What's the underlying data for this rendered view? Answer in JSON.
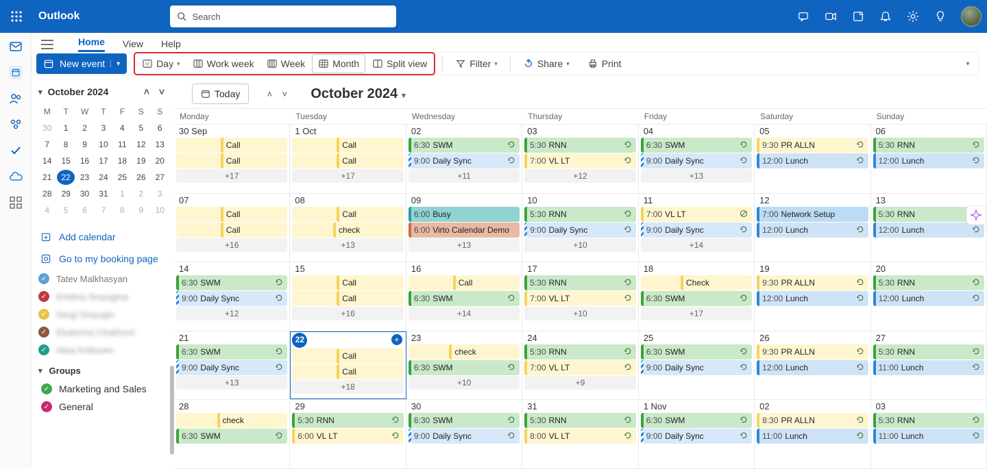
{
  "app": {
    "name": "Outlook"
  },
  "search": {
    "placeholder": "Search"
  },
  "tabs": {
    "home": "Home",
    "view": "View",
    "help": "Help"
  },
  "toolbar": {
    "newEvent": "New event",
    "day": "Day",
    "workweek": "Work week",
    "week": "Week",
    "month": "Month",
    "splitview": "Split view",
    "filter": "Filter",
    "share": "Share",
    "print": "Print"
  },
  "mini": {
    "title": "October 2024",
    "dow": [
      "M",
      "T",
      "W",
      "T",
      "F",
      "S",
      "S"
    ],
    "rows": [
      [
        {
          "n": "30",
          "off": true
        },
        {
          "n": "1"
        },
        {
          "n": "2"
        },
        {
          "n": "3"
        },
        {
          "n": "4"
        },
        {
          "n": "5"
        },
        {
          "n": "6"
        }
      ],
      [
        {
          "n": "7"
        },
        {
          "n": "8"
        },
        {
          "n": "9"
        },
        {
          "n": "10"
        },
        {
          "n": "11"
        },
        {
          "n": "12"
        },
        {
          "n": "13"
        }
      ],
      [
        {
          "n": "14"
        },
        {
          "n": "15"
        },
        {
          "n": "16"
        },
        {
          "n": "17"
        },
        {
          "n": "18"
        },
        {
          "n": "19"
        },
        {
          "n": "20"
        }
      ],
      [
        {
          "n": "21"
        },
        {
          "n": "22",
          "today": true
        },
        {
          "n": "23"
        },
        {
          "n": "24"
        },
        {
          "n": "25"
        },
        {
          "n": "26"
        },
        {
          "n": "27"
        }
      ],
      [
        {
          "n": "28"
        },
        {
          "n": "29"
        },
        {
          "n": "30"
        },
        {
          "n": "31"
        },
        {
          "n": "1",
          "off": true
        },
        {
          "n": "2",
          "off": true
        },
        {
          "n": "3",
          "off": true
        }
      ],
      [
        {
          "n": "4",
          "off": true
        },
        {
          "n": "5",
          "off": true
        },
        {
          "n": "6",
          "off": true
        },
        {
          "n": "7",
          "off": true
        },
        {
          "n": "8",
          "off": true
        },
        {
          "n": "9",
          "off": true
        },
        {
          "n": "10",
          "off": true
        }
      ]
    ]
  },
  "sideactions": {
    "addCalendar": "Add calendar",
    "booking": "Go to my booking page"
  },
  "people": [
    {
      "name": "Tatev Malkhasyan",
      "color": "#5fa0d8"
    },
    {
      "name": "Kristina Smyugina",
      "color": "#c43b3b"
    },
    {
      "name": "Sergi Smyugin",
      "color": "#e9c44a"
    },
    {
      "name": "Ekaterina Chukhont",
      "color": "#8c5a3b"
    },
    {
      "name": "Alisa Kettunen",
      "color": "#1f9e8a"
    }
  ],
  "groups": {
    "title": "Groups",
    "items": [
      {
        "name": "Marketing and Sales",
        "color": "#3fa64f"
      },
      {
        "name": "General",
        "color": "#c72b78"
      }
    ]
  },
  "monthHeader": {
    "today": "Today",
    "title": "October 2024"
  },
  "dow": [
    "Monday",
    "Tuesday",
    "Wednesday",
    "Thursday",
    "Friday",
    "Saturday",
    "Sunday"
  ],
  "weeks": [
    [
      {
        "num": "30 Sep",
        "events": [
          {
            "c": "yellow",
            "label": "Call",
            "center": true
          },
          {
            "c": "yellow",
            "label": "Call",
            "center": true
          }
        ],
        "more": "+17"
      },
      {
        "num": "1 Oct",
        "events": [
          {
            "c": "yellow",
            "label": "Call",
            "center": true
          },
          {
            "c": "yellow",
            "label": "Call",
            "center": true
          }
        ],
        "more": "+17"
      },
      {
        "num": "02",
        "events": [
          {
            "c": "green",
            "time": "6:30",
            "label": "SWM",
            "rec": true
          },
          {
            "c": "hatch-blue",
            "time": "9:00",
            "label": "Daily Sync",
            "rec": true
          }
        ],
        "more": "+11"
      },
      {
        "num": "03",
        "events": [
          {
            "c": "green",
            "time": "5:30",
            "label": "RNN",
            "rec": true
          },
          {
            "c": "yellow",
            "time": "7:00",
            "label": "VL LT",
            "rec": true
          }
        ],
        "more": "+12"
      },
      {
        "num": "04",
        "events": [
          {
            "c": "green",
            "time": "6:30",
            "label": "SWM",
            "rec": true
          },
          {
            "c": "hatch-blue",
            "time": "9:00",
            "label": "Daily Sync",
            "rec": true
          }
        ],
        "more": "+13"
      },
      {
        "num": "05",
        "events": [
          {
            "c": "yellow",
            "time": "9:30",
            "label": "PR ALLN",
            "rec": true
          },
          {
            "c": "blue",
            "time": "12:00",
            "label": "Lunch",
            "rec": true
          }
        ]
      },
      {
        "num": "06",
        "events": [
          {
            "c": "green",
            "time": "5:30",
            "label": "RNN",
            "rec": true
          },
          {
            "c": "blue",
            "time": "12:00",
            "label": "Lunch",
            "rec": true
          }
        ]
      }
    ],
    [
      {
        "num": "07",
        "events": [
          {
            "c": "yellow",
            "label": "Call",
            "center": true
          },
          {
            "c": "yellow",
            "label": "Call",
            "center": true
          }
        ],
        "more": "+16"
      },
      {
        "num": "08",
        "events": [
          {
            "c": "yellow",
            "label": "Call",
            "center": true
          },
          {
            "c": "yellow",
            "label": "check",
            "center": true
          }
        ],
        "more": "+13"
      },
      {
        "num": "09",
        "events": [
          {
            "c": "teal",
            "time": "6:00",
            "label": "Busy"
          },
          {
            "c": "peach",
            "time": "6:00",
            "label": "Virto Calendar Demo"
          }
        ],
        "more": "+13"
      },
      {
        "num": "10",
        "events": [
          {
            "c": "green",
            "time": "5:30",
            "label": "RNN",
            "rec": true
          },
          {
            "c": "hatch-blue",
            "time": "9:00",
            "label": "Daily Sync",
            "rec": true
          }
        ],
        "more": "+10"
      },
      {
        "num": "11",
        "events": [
          {
            "c": "yellow",
            "time": "7:00",
            "label": "VL LT",
            "cancel": true
          },
          {
            "c": "hatch-blue",
            "time": "9:00",
            "label": "Daily Sync",
            "rec": true
          }
        ],
        "more": "+14"
      },
      {
        "num": "12",
        "events": [
          {
            "c": "blue2",
            "time": "7:00",
            "label": "Network Setup"
          },
          {
            "c": "blue",
            "time": "12:00",
            "label": "Lunch",
            "rec": true
          }
        ]
      },
      {
        "num": "13",
        "events": [
          {
            "c": "green",
            "time": "5:30",
            "label": "RNN",
            "rec": true
          },
          {
            "c": "blue",
            "time": "12:00",
            "label": "Lunch",
            "rec": true
          }
        ]
      }
    ],
    [
      {
        "num": "14",
        "events": [
          {
            "c": "green",
            "time": "6:30",
            "label": "SWM",
            "rec": true
          },
          {
            "c": "hatch-blue",
            "time": "9:00",
            "label": "Daily Sync",
            "rec": true
          }
        ],
        "more": "+12"
      },
      {
        "num": "15",
        "events": [
          {
            "c": "yellow",
            "label": "Call",
            "center": true
          },
          {
            "c": "yellow",
            "label": "Call",
            "center": true
          }
        ],
        "more": "+16"
      },
      {
        "num": "16",
        "events": [
          {
            "c": "yellow",
            "label": "Call",
            "center": true
          },
          {
            "c": "green",
            "time": "6:30",
            "label": "SWM",
            "rec": true
          }
        ],
        "more": "+14"
      },
      {
        "num": "17",
        "events": [
          {
            "c": "green",
            "time": "5:30",
            "label": "RNN",
            "rec": true
          },
          {
            "c": "yellow",
            "time": "7:00",
            "label": "VL LT",
            "rec": true
          }
        ],
        "more": "+10"
      },
      {
        "num": "18",
        "events": [
          {
            "c": "yellow",
            "label": "Check",
            "center": true
          },
          {
            "c": "green",
            "time": "6:30",
            "label": "SWM",
            "rec": true
          }
        ],
        "more": "+17"
      },
      {
        "num": "19",
        "events": [
          {
            "c": "yellow",
            "time": "9:30",
            "label": "PR ALLN",
            "rec": true
          },
          {
            "c": "blue",
            "time": "12:00",
            "label": "Lunch",
            "rec": true
          }
        ]
      },
      {
        "num": "20",
        "events": [
          {
            "c": "green",
            "time": "5:30",
            "label": "RNN",
            "rec": true
          },
          {
            "c": "blue",
            "time": "12:00",
            "label": "Lunch",
            "rec": true
          }
        ]
      }
    ],
    [
      {
        "num": "21",
        "events": [
          {
            "c": "green",
            "time": "6:30",
            "label": "SWM",
            "rec": true
          },
          {
            "c": "hatch-blue",
            "time": "9:00",
            "label": "Daily Sync",
            "rec": true
          }
        ],
        "more": "+13"
      },
      {
        "num": "22",
        "today": true,
        "events": [
          {
            "c": "yellow",
            "label": "Call",
            "center": true
          },
          {
            "c": "yellow",
            "label": "Call",
            "center": true
          }
        ],
        "more": "+18"
      },
      {
        "num": "23",
        "events": [
          {
            "c": "yellow",
            "label": "check",
            "center": true
          },
          {
            "c": "green",
            "time": "6:30",
            "label": "SWM",
            "rec": true
          }
        ],
        "more": "+10"
      },
      {
        "num": "24",
        "events": [
          {
            "c": "green",
            "time": "5:30",
            "label": "RNN",
            "rec": true
          },
          {
            "c": "yellow",
            "time": "7:00",
            "label": "VL LT",
            "rec": true
          }
        ],
        "more": "+9"
      },
      {
        "num": "25",
        "events": [
          {
            "c": "green",
            "time": "6:30",
            "label": "SWM",
            "rec": true
          },
          {
            "c": "hatch-blue",
            "time": "9:00",
            "label": "Daily Sync",
            "rec": true
          }
        ]
      },
      {
        "num": "26",
        "events": [
          {
            "c": "yellow",
            "time": "9:30",
            "label": "PR ALLN",
            "rec": true
          },
          {
            "c": "blue",
            "time": "12:00",
            "label": "Lunch",
            "rec": true
          }
        ]
      },
      {
        "num": "27",
        "events": [
          {
            "c": "green",
            "time": "5:30",
            "label": "RNN",
            "rec": true
          },
          {
            "c": "blue",
            "time": "11:00",
            "label": "Lunch",
            "rec": true
          }
        ]
      }
    ],
    [
      {
        "num": "28",
        "events": [
          {
            "c": "yellow",
            "label": "check",
            "center": true
          },
          {
            "c": "green",
            "time": "6:30",
            "label": "SWM",
            "rec": true
          }
        ]
      },
      {
        "num": "29",
        "events": [
          {
            "c": "green",
            "time": "5:30",
            "label": "RNN",
            "rec": true
          },
          {
            "c": "yellow",
            "time": "6:00",
            "label": "VL LT",
            "rec": true
          }
        ]
      },
      {
        "num": "30",
        "events": [
          {
            "c": "green",
            "time": "6:30",
            "label": "SWM",
            "rec": true
          },
          {
            "c": "hatch-blue",
            "time": "9:00",
            "label": "Daily Sync",
            "rec": true
          }
        ]
      },
      {
        "num": "31",
        "events": [
          {
            "c": "green",
            "time": "5:30",
            "label": "RNN",
            "rec": true
          },
          {
            "c": "yellow",
            "time": "8:00",
            "label": "VL LT",
            "rec": true
          }
        ]
      },
      {
        "num": "1 Nov",
        "events": [
          {
            "c": "green",
            "time": "6:30",
            "label": "SWM",
            "rec": true
          },
          {
            "c": "hatch-blue",
            "time": "9:00",
            "label": "Daily Sync",
            "rec": true
          }
        ]
      },
      {
        "num": "02",
        "events": [
          {
            "c": "yellow",
            "time": "8:30",
            "label": "PR ALLN",
            "rec": true
          },
          {
            "c": "blue",
            "time": "11:00",
            "label": "Lunch",
            "rec": true
          }
        ]
      },
      {
        "num": "03",
        "events": [
          {
            "c": "green",
            "time": "5:30",
            "label": "RNN",
            "rec": true
          },
          {
            "c": "blue",
            "time": "11:00",
            "label": "Lunch",
            "rec": true
          }
        ]
      }
    ]
  ]
}
